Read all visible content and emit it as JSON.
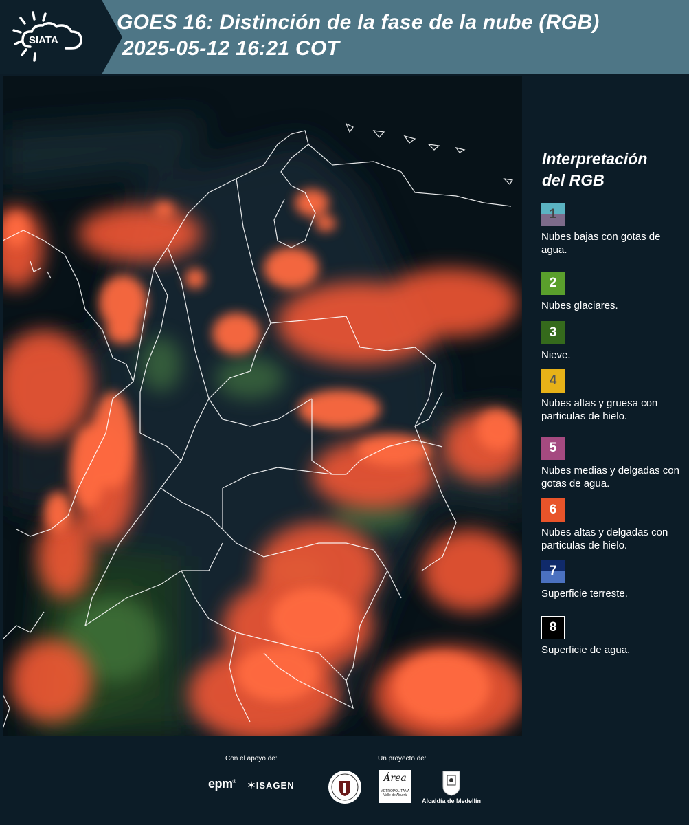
{
  "header": {
    "logo_text": "SIATA",
    "title_line1": "GOES 16: Distinción de la fase de la nube (RGB)",
    "title_line2": "2025-05-12 16:21 COT"
  },
  "legend": {
    "title_line1": "Interpretación",
    "title_line2": "del RGB",
    "items": [
      {
        "num": "1",
        "label": "Nubes bajas con gotas de agua.",
        "color_top": "#5bb3c2",
        "color_bottom": "#7d6b8a",
        "num_color": "#444444"
      },
      {
        "num": "2",
        "label": "Nubes glaciares.",
        "color_top": "#5a9f2c",
        "color_bottom": "#5a9f2c",
        "num_color": "#ffffff"
      },
      {
        "num": "3",
        "label": "Nieve.",
        "color_top": "#356a1c",
        "color_bottom": "#356a1c",
        "num_color": "#ffffff"
      },
      {
        "num": "4",
        "label": "Nubes altas y gruesa con particulas de hielo.",
        "color_top": "#e7b218",
        "color_bottom": "#e7b218",
        "num_color": "#555555"
      },
      {
        "num": "5",
        "label": "Nubes medias y delgadas con gotas de agua.",
        "color_top": "#a54a80",
        "color_bottom": "#a54a80",
        "num_color": "#ffffff"
      },
      {
        "num": "6",
        "label": "Nubes altas y delgadas con particulas de hielo.",
        "color_top": "#e8542a",
        "color_bottom": "#e8542a",
        "num_color": "#ffffff"
      },
      {
        "num": "7",
        "label": "Superficie terreste.",
        "color_top": "#102a6a",
        "color_bottom": "#4b71c0",
        "num_color": "#ffffff"
      },
      {
        "num": "8",
        "label": "Superficie de agua.",
        "color_top": "#000000",
        "color_bottom": "#000000",
        "num_color": "#ffffff"
      }
    ]
  },
  "footer": {
    "support_label": "Con el apoyo de:",
    "project_label": "Un proyecto de:",
    "epm_text": "epm",
    "isagen_text": "ISAGEN",
    "area_text": "Área",
    "area_sub": "METROPOLITANA Valle de Aburrá",
    "alcaldia_text": "Alcaldía de Medellín"
  },
  "map": {
    "ocean_color": "#071218",
    "cloud_color": "#ff5a35",
    "border_color": "#ffffff"
  }
}
